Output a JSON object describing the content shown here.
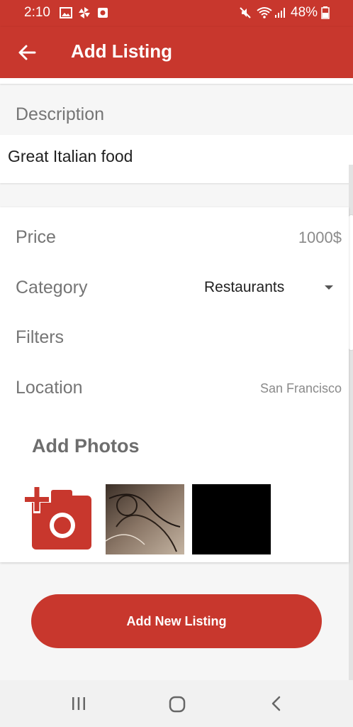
{
  "status_bar": {
    "time": "2:10",
    "battery": "48%",
    "icons": [
      "image-icon",
      "pinwheel-icon",
      "app-icon",
      "mute-icon",
      "wifi-icon",
      "signal-icon",
      "battery-icon"
    ]
  },
  "app_bar": {
    "title": "Add Listing",
    "back_icon": "arrow-back-icon"
  },
  "description": {
    "label": "Description",
    "value": "Great Italian food"
  },
  "form": {
    "price": {
      "label": "Price",
      "value": "1000$"
    },
    "category": {
      "label": "Category",
      "value": "Restaurants"
    },
    "filters": {
      "label": "Filters"
    },
    "location": {
      "label": "Location",
      "value": "San Francisco"
    }
  },
  "photos": {
    "title": "Add Photos",
    "add_icon": "add-a-photo-icon",
    "items": [
      "photo-thumbnail",
      "photo-thumbnail"
    ]
  },
  "submit_button": {
    "label": "Add New Listing"
  },
  "nav_bar": {
    "icons": [
      "recent-apps-icon",
      "home-icon",
      "back-icon"
    ]
  },
  "colors": {
    "accent": "#c8372d",
    "label": "#757575",
    "background": "#f6f6f6"
  }
}
